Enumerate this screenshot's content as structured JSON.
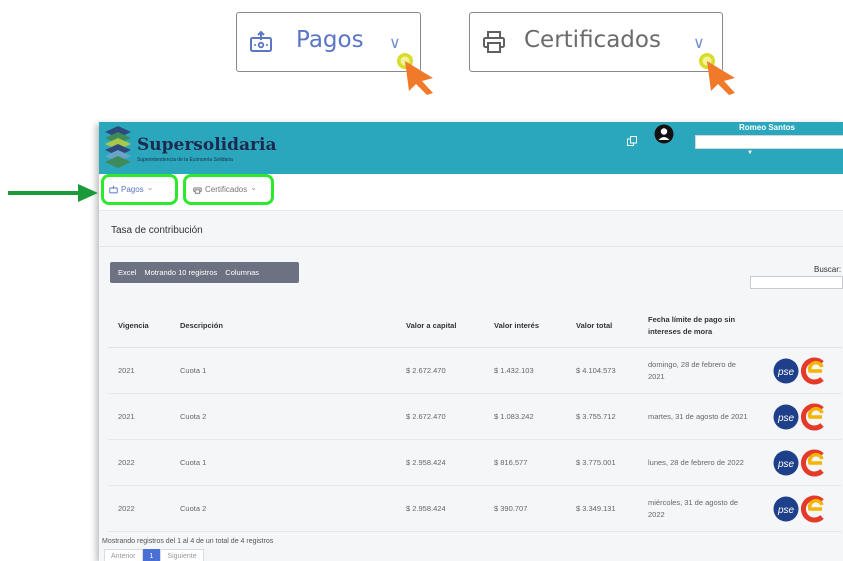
{
  "callouts": {
    "pagos": {
      "label": "Pagos",
      "icon": "payment-upload-icon",
      "chevron": "∨"
    },
    "certificados": {
      "label": "Certificados",
      "icon": "printer-icon",
      "chevron": "∨"
    }
  },
  "header": {
    "brand": "Supersolidaria",
    "brand_sub": "Superintendencia de la Economía Solidaria",
    "user_name": "Romeo Santos",
    "user_caret": "▼"
  },
  "nav": {
    "pagos": "Pagos",
    "certificados": "Certificados",
    "chevron": "⌄"
  },
  "page": {
    "section_title": "Tasa de contribución"
  },
  "toolbar": {
    "excel": "Excel",
    "show": "Motrando 10 registros",
    "columns": "Columnas"
  },
  "search": {
    "label": "Buscar:"
  },
  "table": {
    "headers": [
      "Vigencia",
      "Descripción",
      "Valor a capital",
      "Valor interés",
      "Valor total",
      "Fecha límite de pago sin intereses de mora",
      ""
    ],
    "rows": [
      {
        "vigencia": "2021",
        "descripcion": "Cuota 1",
        "capital": "$ 2.672.470",
        "interes": "$ 1.432.103",
        "total": "$ 4.104.573",
        "fecha": "domingo, 28 de febrero de 2021"
      },
      {
        "vigencia": "2021",
        "descripcion": "Cuota 2",
        "capital": "$ 2.672.470",
        "interes": "$ 1.083.242",
        "total": "$ 3.755.712",
        "fecha": "martes, 31 de agosto de 2021"
      },
      {
        "vigencia": "2022",
        "descripcion": "Cuota 1",
        "capital": "$ 2.958.424",
        "interes": "$ 816.577",
        "total": "$ 3.775.001",
        "fecha": "lunes, 28 de febrero de 2022"
      },
      {
        "vigencia": "2022",
        "descripcion": "Cuota 2",
        "capital": "$ 2.958.424",
        "interes": "$ 390.707",
        "total": "$ 3.349.131",
        "fecha": "miércoles, 31 de agosto de 2022"
      }
    ],
    "pse_label": "pse"
  },
  "footer": {
    "info": "Mostrando registros del 1 al 4 de un total de 4 registros",
    "prev": "Anterior",
    "page": "1",
    "next": "Siguiente"
  },
  "colors": {
    "header_bg": "#2ba7bd",
    "highlight": "#2ee82e",
    "arrow": "#1a9a3a",
    "cursor": "#f07a2a",
    "toolbar": "#6c7281"
  }
}
